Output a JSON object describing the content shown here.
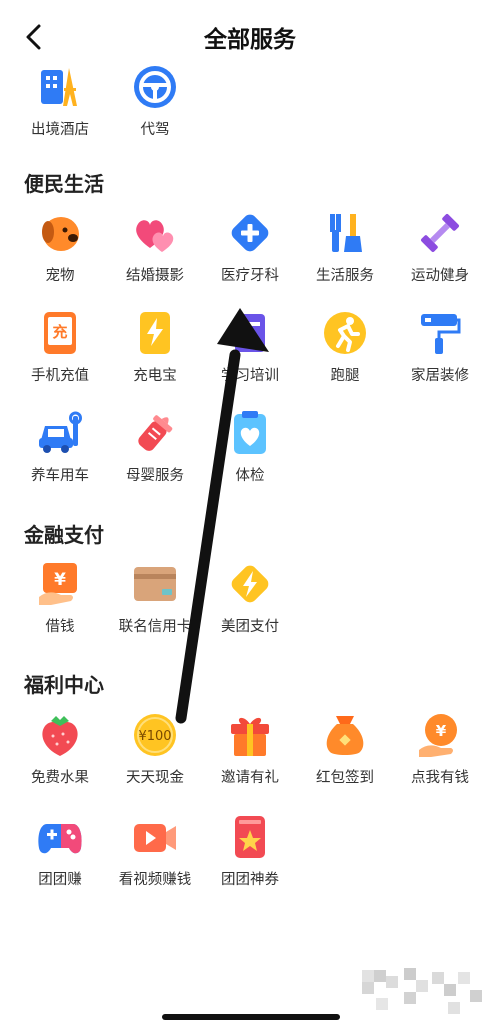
{
  "header": {
    "title": "全部服务"
  },
  "sections": [
    {
      "title": "",
      "items": [
        {
          "label": "出境酒店",
          "icon": "hotel-tower-icon"
        },
        {
          "label": "代驾",
          "icon": "steering-wheel-icon"
        }
      ]
    },
    {
      "title": "便民生活",
      "items": [
        {
          "label": "宠物",
          "icon": "dog-icon"
        },
        {
          "label": "结婚摄影",
          "icon": "hearts-icon"
        },
        {
          "label": "医疗牙科",
          "icon": "medical-cross-icon"
        },
        {
          "label": "生活服务",
          "icon": "tools-icon"
        },
        {
          "label": "运动健身",
          "icon": "dumbbell-icon"
        },
        {
          "label": "手机充值",
          "icon": "phone-recharge-icon"
        },
        {
          "label": "充电宝",
          "icon": "power-bank-icon"
        },
        {
          "label": "学习培训",
          "icon": "study-icon"
        },
        {
          "label": "跑腿",
          "icon": "runner-icon"
        },
        {
          "label": "家居装修",
          "icon": "paint-roller-icon"
        },
        {
          "label": "养车用车",
          "icon": "car-service-icon"
        },
        {
          "label": "母婴服务",
          "icon": "baby-bottle-icon"
        },
        {
          "label": "体检",
          "icon": "health-check-icon"
        }
      ]
    },
    {
      "title": "金融支付",
      "items": [
        {
          "label": "借钱",
          "icon": "loan-icon"
        },
        {
          "label": "联名信用卡",
          "icon": "credit-card-icon"
        },
        {
          "label": "美团支付",
          "icon": "lightning-pay-icon"
        }
      ]
    },
    {
      "title": "福利中心",
      "items": [
        {
          "label": "免费水果",
          "icon": "strawberry-icon"
        },
        {
          "label": "天天现金",
          "icon": "coin-icon",
          "coin_text": "¥100"
        },
        {
          "label": "邀请有礼",
          "icon": "gift-box-icon"
        },
        {
          "label": "红包签到",
          "icon": "money-bag-icon"
        },
        {
          "label": "点我有钱",
          "icon": "coin-hand-icon"
        },
        {
          "label": "团团赚",
          "icon": "gamepad-icon"
        },
        {
          "label": "看视频赚钱",
          "icon": "video-icon"
        },
        {
          "label": "团团神券",
          "icon": "coupon-icon"
        }
      ]
    }
  ],
  "colors": {
    "accent_blue": "#2f7bf5",
    "accent_orange": "#ff8a2a",
    "accent_red": "#f24a53",
    "accent_purple": "#8c4ce0",
    "accent_yellow": "#ffc422"
  }
}
